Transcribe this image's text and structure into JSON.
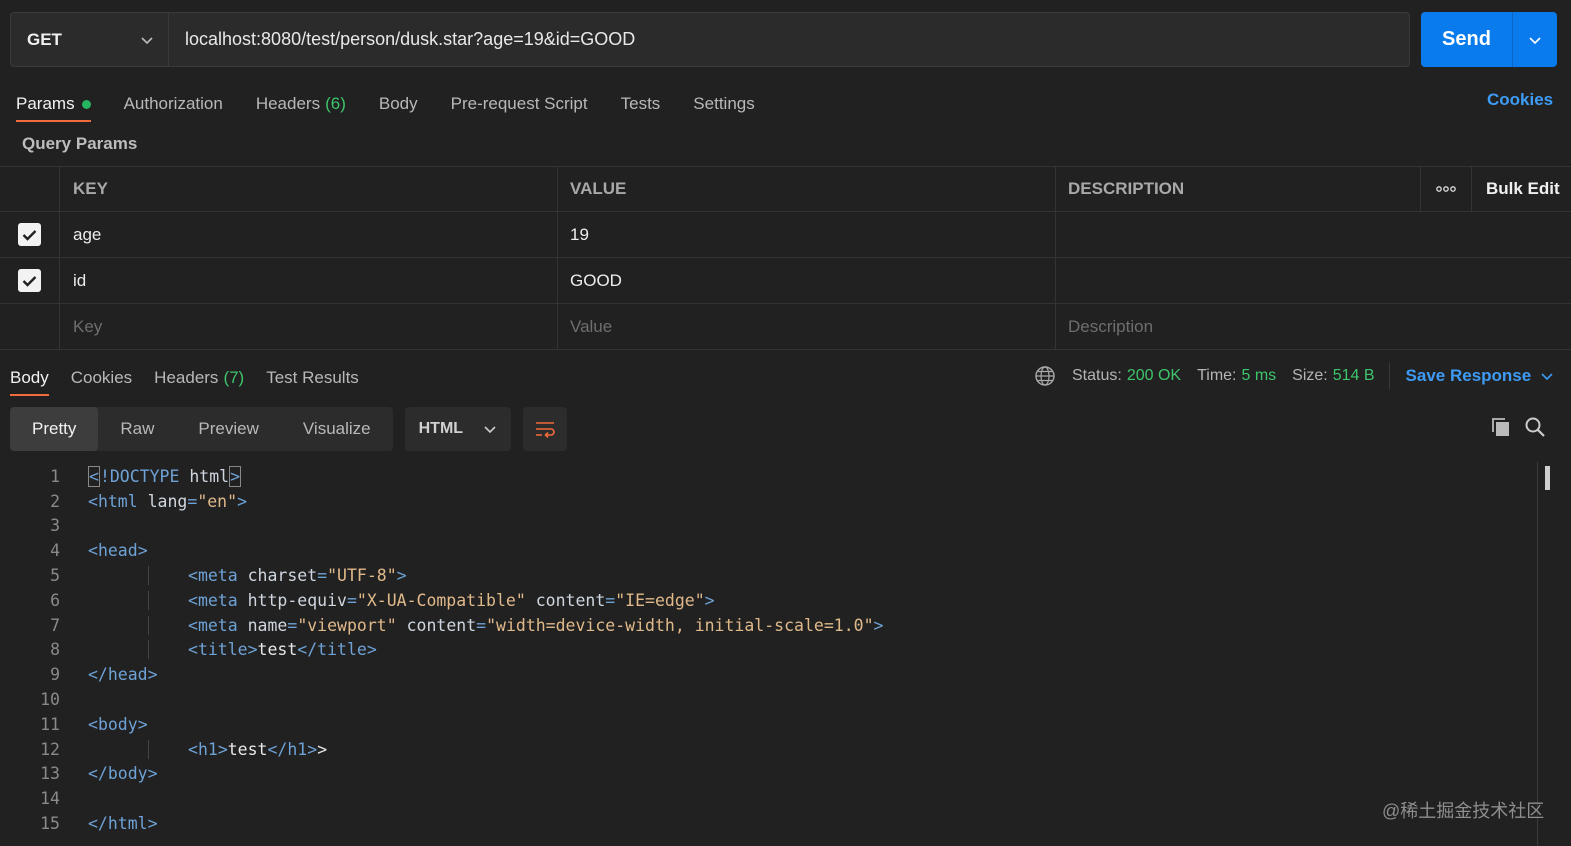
{
  "request": {
    "method": "GET",
    "url": "localhost:8080/test/person/dusk.star?age=19&id=GOOD",
    "send_label": "Send"
  },
  "req_tabs": {
    "params": "Params",
    "authorization": "Authorization",
    "headers": "Headers",
    "headers_count": "(6)",
    "body": "Body",
    "prerequest": "Pre-request Script",
    "tests": "Tests",
    "settings": "Settings",
    "cookies": "Cookies"
  },
  "query_params": {
    "title": "Query Params",
    "columns": {
      "key": "KEY",
      "value": "VALUE",
      "description": "DESCRIPTION",
      "bulk_edit": "Bulk Edit"
    },
    "rows": [
      {
        "key": "age",
        "value": "19"
      },
      {
        "key": "id",
        "value": "GOOD"
      }
    ],
    "placeholders": {
      "key": "Key",
      "value": "Value",
      "description": "Description"
    }
  },
  "response": {
    "tabs": {
      "body": "Body",
      "cookies": "Cookies",
      "headers": "Headers",
      "headers_count": "(7)",
      "test_results": "Test Results"
    },
    "status_label": "Status:",
    "status_value": "200 OK",
    "time_label": "Time:",
    "time_value": "5 ms",
    "size_label": "Size:",
    "size_value": "514 B",
    "save_label": "Save Response",
    "views": {
      "pretty": "Pretty",
      "raw": "Raw",
      "preview": "Preview",
      "visualize": "Visualize"
    },
    "format": "HTML"
  },
  "code_lines": [
    "1",
    "2",
    "3",
    "4",
    "5",
    "6",
    "7",
    "8",
    "9",
    "10",
    "11",
    "12",
    "13",
    "14",
    "15"
  ],
  "code": {
    "doctype": "!DOCTYPE",
    "html_kw": "html",
    "html": "html",
    "lang": "lang",
    "en": "\"en\"",
    "head": "head",
    "meta": "meta",
    "charset": "charset",
    "utf8": "\"UTF-8\"",
    "http_equiv": "http-equiv",
    "xua": "\"X-UA-Compatible\"",
    "content": "content",
    "ie_edge": "\"IE=edge\"",
    "name": "name",
    "viewport": "\"viewport\"",
    "viewport_content": "\"width=device-width, initial-scale=1.0\"",
    "title": "title",
    "title_text": "test",
    "body": "body",
    "h1": "h1",
    "h1_text": "test"
  },
  "watermark": "@稀土掘金技术社区",
  "icons": [
    "chevron-down-icon",
    "check-icon",
    "more-icon",
    "globe-icon",
    "wrap-icon",
    "copy-icon",
    "search-icon"
  ]
}
